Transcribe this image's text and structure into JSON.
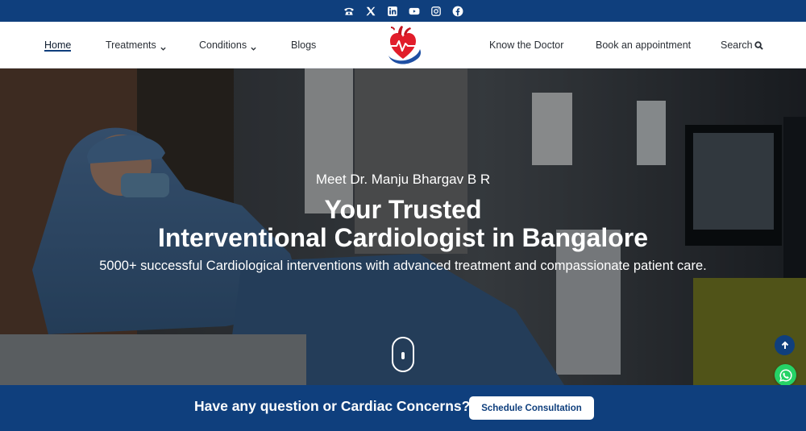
{
  "social": {
    "icons": [
      "phone-icon",
      "x-twitter-icon",
      "linkedin-icon",
      "youtube-icon",
      "instagram-icon",
      "facebook-icon"
    ]
  },
  "nav": {
    "home": "Home",
    "treatments": "Treatments",
    "conditions": "Conditions",
    "blogs": "Blogs",
    "doctor": "Know the Doctor",
    "book": "Book an appointment",
    "search": "Search"
  },
  "hero": {
    "kicker": "Meet Dr. Manju Bhargav B R",
    "title_line1": "Your Trusted",
    "title_line2": "Interventional Cardiologist in Bangalore",
    "subtitle": "5000+ successful Cardiological interventions with advanced treatment and compassionate patient care."
  },
  "cta": {
    "question": "Have any question or Cardiac Concerns?",
    "button": "Schedule Consultation"
  },
  "colors": {
    "brand_navy": "#0f3f7d",
    "logo_red": "#e11d2a",
    "whatsapp_green": "#25d366"
  }
}
